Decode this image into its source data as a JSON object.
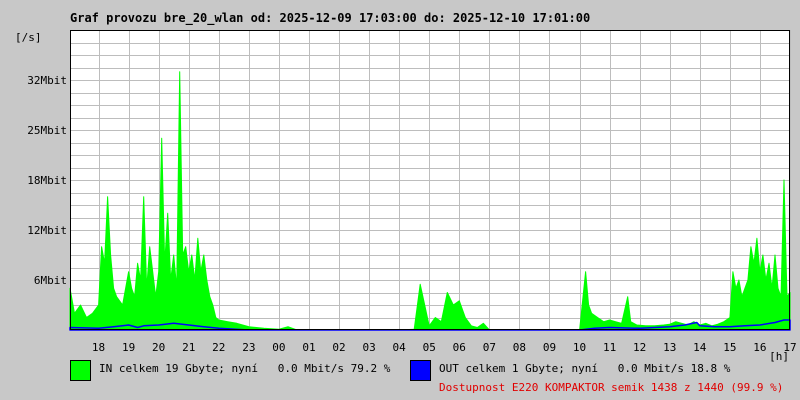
{
  "title": "Graf provozu bre_20_wlan od: 2025-12-09 17:03:00 do: 2025-12-10 17:01:00",
  "colors": {
    "background": "#c8c8c8",
    "plot": "#ffffff",
    "grid": "#bdbdbd",
    "in": "#00ff00",
    "out": "#0000ff",
    "availability": "#e00000"
  },
  "legend": {
    "in_text": "IN celkem 19 Gbyte; nyní   0.0 Mbit/s 79.2 %",
    "out_text": "OUT celkem 1 Gbyte; nyní   0.0 Mbit/s 18.8 %",
    "availability_text": "Dostupnost E220 KOMPAKTOR semik 1438 z 1440 (99.9 %)"
  },
  "chart_data": {
    "type": "area",
    "title": "Graf provozu bre_20_wlan od: 2025-12-09 17:03:00 do: 2025-12-10 17:01:00",
    "xlabel": "[h]",
    "ylabel": "[/s]",
    "x_tick_labels": [
      "18",
      "19",
      "20",
      "21",
      "22",
      "23",
      "00",
      "01",
      "02",
      "03",
      "04",
      "05",
      "06",
      "07",
      "08",
      "09",
      "10",
      "11",
      "12",
      "13",
      "14",
      "15",
      "16",
      "17"
    ],
    "y_tick_labels": [
      "6Mbit",
      "12Mbit",
      "18Mbit",
      "25Mbit",
      "32Mbit"
    ],
    "y_tick_values": [
      6,
      12,
      18,
      24,
      30
    ],
    "xlim": [
      17.05,
      41.0
    ],
    "ylim": [
      0,
      36
    ],
    "x_unit": "hours from 2025-12-09 00:00",
    "y_unit": "Mbit/s",
    "grid": true,
    "series": [
      {
        "name": "IN",
        "color": "#00ff00",
        "points": [
          [
            17.05,
            5
          ],
          [
            17.2,
            2
          ],
          [
            17.4,
            3
          ],
          [
            17.6,
            1.5
          ],
          [
            17.8,
            2
          ],
          [
            18.0,
            3
          ],
          [
            18.1,
            10
          ],
          [
            18.2,
            8
          ],
          [
            18.3,
            16
          ],
          [
            18.4,
            9
          ],
          [
            18.5,
            5
          ],
          [
            18.6,
            4
          ],
          [
            18.8,
            3
          ],
          [
            19.0,
            7
          ],
          [
            19.1,
            5
          ],
          [
            19.2,
            4
          ],
          [
            19.3,
            8
          ],
          [
            19.4,
            6
          ],
          [
            19.5,
            16
          ],
          [
            19.6,
            5
          ],
          [
            19.7,
            10
          ],
          [
            19.8,
            7
          ],
          [
            19.9,
            4
          ],
          [
            20.0,
            7
          ],
          [
            20.1,
            23
          ],
          [
            20.2,
            8
          ],
          [
            20.3,
            14
          ],
          [
            20.4,
            6
          ],
          [
            20.5,
            9
          ],
          [
            20.6,
            5
          ],
          [
            20.7,
            31
          ],
          [
            20.8,
            9
          ],
          [
            20.9,
            10
          ],
          [
            21.0,
            7
          ],
          [
            21.1,
            9
          ],
          [
            21.2,
            6
          ],
          [
            21.3,
            11
          ],
          [
            21.4,
            7
          ],
          [
            21.5,
            9
          ],
          [
            21.6,
            6
          ],
          [
            21.7,
            4
          ],
          [
            21.8,
            3
          ],
          [
            21.9,
            1.5
          ],
          [
            22.0,
            1.2
          ],
          [
            22.3,
            1
          ],
          [
            22.6,
            0.8
          ],
          [
            23.0,
            0.4
          ],
          [
            23.5,
            0.2
          ],
          [
            24.0,
            0.1
          ],
          [
            24.3,
            0.4
          ],
          [
            24.6,
            0
          ],
          [
            28.0,
            0
          ],
          [
            28.5,
            0.1
          ],
          [
            28.7,
            5.5
          ],
          [
            28.85,
            3
          ],
          [
            29.0,
            0.5
          ],
          [
            29.2,
            1.5
          ],
          [
            29.4,
            1
          ],
          [
            29.6,
            4.5
          ],
          [
            29.8,
            3
          ],
          [
            30.0,
            3.5
          ],
          [
            30.2,
            1.5
          ],
          [
            30.4,
            0.5
          ],
          [
            30.6,
            0.3
          ],
          [
            30.8,
            0.8
          ],
          [
            31.0,
            0
          ],
          [
            34.0,
            0
          ],
          [
            34.2,
            7
          ],
          [
            34.3,
            3
          ],
          [
            34.4,
            2
          ],
          [
            34.6,
            1.5
          ],
          [
            34.8,
            1
          ],
          [
            35.0,
            1.2
          ],
          [
            35.2,
            1
          ],
          [
            35.4,
            0.8
          ],
          [
            35.6,
            4
          ],
          [
            35.7,
            1
          ],
          [
            35.9,
            0.6
          ],
          [
            36.2,
            0.5
          ],
          [
            36.5,
            0.5
          ],
          [
            36.8,
            0.6
          ],
          [
            37.0,
            0.7
          ],
          [
            37.2,
            1
          ],
          [
            37.4,
            0.8
          ],
          [
            37.6,
            0.6
          ],
          [
            37.8,
            1
          ],
          [
            38.0,
            0.6
          ],
          [
            38.2,
            0.8
          ],
          [
            38.4,
            0.5
          ],
          [
            38.6,
            0.7
          ],
          [
            38.8,
            1
          ],
          [
            39.0,
            1.5
          ],
          [
            39.1,
            7
          ],
          [
            39.2,
            5
          ],
          [
            39.3,
            6
          ],
          [
            39.4,
            4
          ],
          [
            39.5,
            5
          ],
          [
            39.6,
            6
          ],
          [
            39.7,
            10
          ],
          [
            39.8,
            8
          ],
          [
            39.9,
            11
          ],
          [
            40.0,
            7
          ],
          [
            40.1,
            9
          ],
          [
            40.2,
            6
          ],
          [
            40.3,
            8
          ],
          [
            40.4,
            5
          ],
          [
            40.5,
            9
          ],
          [
            40.6,
            5
          ],
          [
            40.7,
            4
          ],
          [
            40.8,
            18
          ],
          [
            40.9,
            4
          ],
          [
            41.0,
            4.5
          ]
        ]
      },
      {
        "name": "OUT",
        "color": "#0000ff",
        "points": [
          [
            17.05,
            0.3
          ],
          [
            18.0,
            0.2
          ],
          [
            18.5,
            0.4
          ],
          [
            19.0,
            0.6
          ],
          [
            19.3,
            0.3
          ],
          [
            19.5,
            0.5
          ],
          [
            20.0,
            0.6
          ],
          [
            20.5,
            0.8
          ],
          [
            21.0,
            0.6
          ],
          [
            21.5,
            0.4
          ],
          [
            22.0,
            0.2
          ],
          [
            23.0,
            0
          ],
          [
            34.0,
            0
          ],
          [
            34.5,
            0.2
          ],
          [
            35.0,
            0.3
          ],
          [
            36.0,
            0.2
          ],
          [
            36.5,
            0.3
          ],
          [
            37.0,
            0.4
          ],
          [
            37.5,
            0.6
          ],
          [
            37.9,
            0.9
          ],
          [
            38.0,
            0.5
          ],
          [
            38.5,
            0.4
          ],
          [
            39.0,
            0.4
          ],
          [
            39.5,
            0.5
          ],
          [
            40.0,
            0.6
          ],
          [
            40.5,
            0.9
          ],
          [
            40.8,
            1.2
          ],
          [
            41.0,
            1.2
          ]
        ]
      }
    ]
  }
}
